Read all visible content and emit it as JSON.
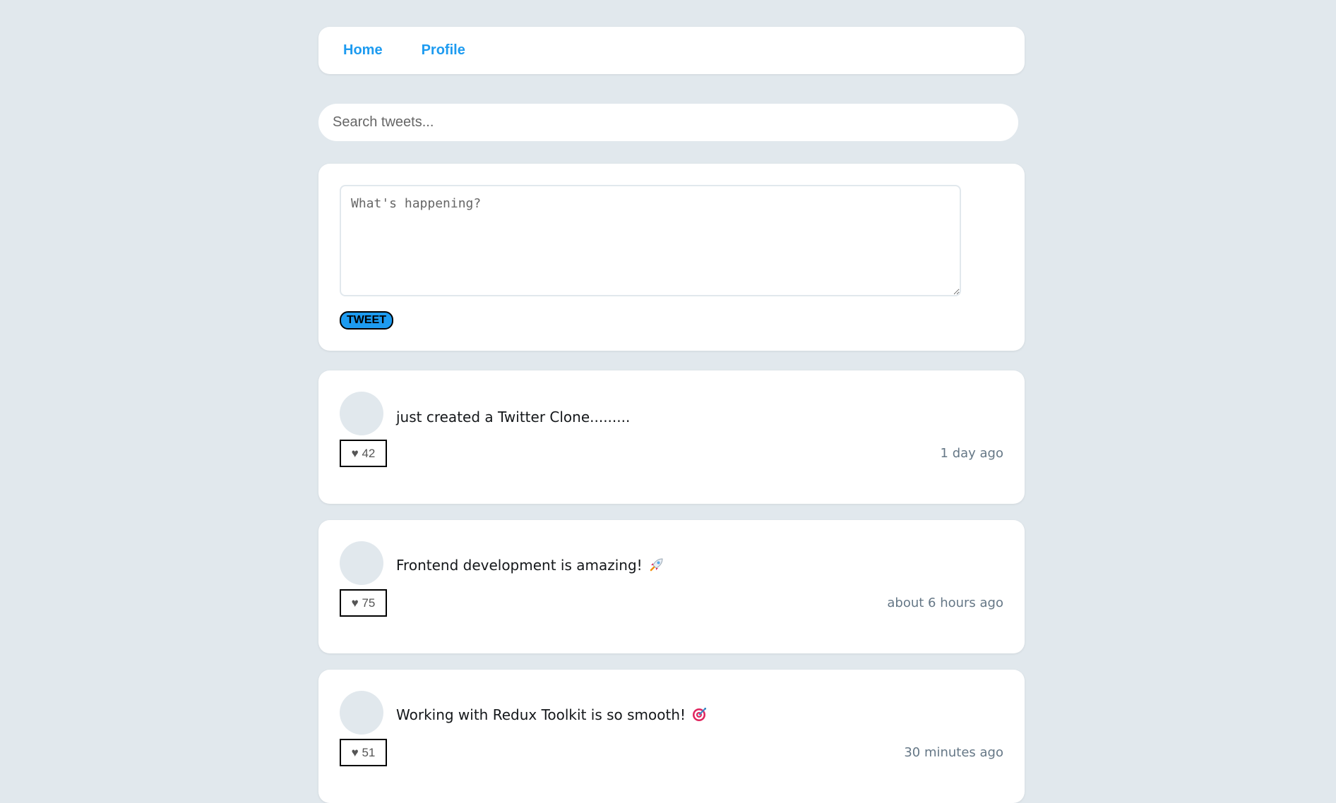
{
  "nav": {
    "home_label": "Home",
    "profile_label": "Profile"
  },
  "search": {
    "placeholder": "Search tweets..."
  },
  "composer": {
    "placeholder": "What's happening?",
    "button_label": "TWEET"
  },
  "colors": {
    "accent": "#1d9bf0",
    "background": "#e1e8ed",
    "card": "#ffffff",
    "muted": "#657786"
  },
  "tweets": [
    {
      "text": "just created a Twitter Clone.........",
      "likes": "♥ 42",
      "time": "1 day ago",
      "emoji_icon": ""
    },
    {
      "text": "Frontend development is amazing!",
      "likes": "♥ 75",
      "time": "about 6 hours ago",
      "emoji_icon": "rocket-icon"
    },
    {
      "text": "Working with Redux Toolkit is so smooth!",
      "likes": "♥ 51",
      "time": "30 minutes ago",
      "emoji_icon": "target-icon"
    }
  ]
}
